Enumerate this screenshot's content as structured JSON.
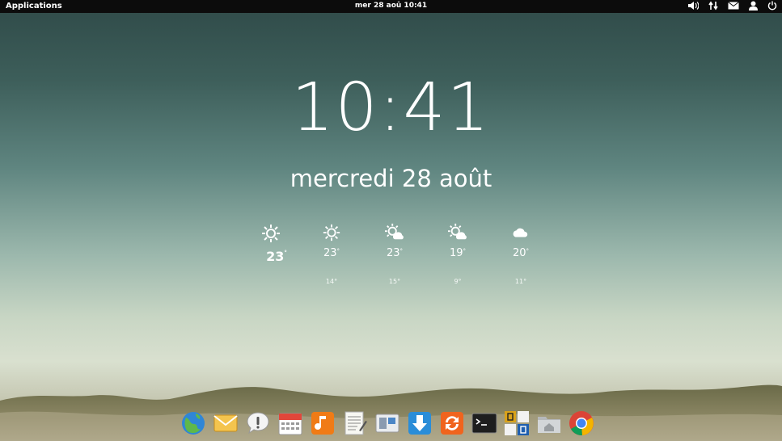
{
  "panel": {
    "applications_label": "Applications",
    "datetime": "mer 28 aoû 10:41",
    "tray_icons": [
      "volume-icon",
      "network-icon",
      "mail-icon",
      "user-icon",
      "power-icon"
    ]
  },
  "lockscreen": {
    "time": "10:41",
    "date": "mercredi 28 août"
  },
  "weather": [
    {
      "icon": "sun-icon",
      "high": "23",
      "low": ""
    },
    {
      "icon": "sun-icon",
      "high": "23",
      "low": "14"
    },
    {
      "icon": "sun-cloud-icon",
      "high": "23",
      "low": "15"
    },
    {
      "icon": "sun-cloud-icon",
      "high": "19",
      "low": "9"
    },
    {
      "icon": "cloud-icon",
      "high": "20",
      "low": "11"
    }
  ],
  "degree_symbol": "°",
  "dock": [
    "browser-icon",
    "mail-icon",
    "notifications-icon",
    "calendar-icon",
    "music-icon",
    "text-editor-icon",
    "workspaces-icon",
    "downloads-icon",
    "software-update-icon",
    "terminal-icon",
    "office-icon",
    "home-folder-icon",
    "chrome-icon"
  ],
  "colors": {
    "panel": "#0c0c0c",
    "text": "#ffffff",
    "dock_orange": "#f07b16",
    "dock_blue": "#2a8dd8"
  }
}
